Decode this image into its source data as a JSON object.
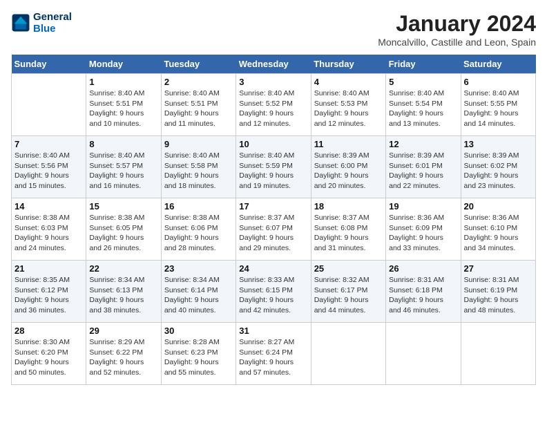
{
  "header": {
    "logo_line1": "General",
    "logo_line2": "Blue",
    "month_title": "January 2024",
    "subtitle": "Moncalvillo, Castille and Leon, Spain"
  },
  "days_of_week": [
    "Sunday",
    "Monday",
    "Tuesday",
    "Wednesday",
    "Thursday",
    "Friday",
    "Saturday"
  ],
  "weeks": [
    [
      {
        "day": "",
        "info": ""
      },
      {
        "day": "1",
        "info": "Sunrise: 8:40 AM\nSunset: 5:51 PM\nDaylight: 9 hours\nand 10 minutes."
      },
      {
        "day": "2",
        "info": "Sunrise: 8:40 AM\nSunset: 5:51 PM\nDaylight: 9 hours\nand 11 minutes."
      },
      {
        "day": "3",
        "info": "Sunrise: 8:40 AM\nSunset: 5:52 PM\nDaylight: 9 hours\nand 12 minutes."
      },
      {
        "day": "4",
        "info": "Sunrise: 8:40 AM\nSunset: 5:53 PM\nDaylight: 9 hours\nand 12 minutes."
      },
      {
        "day": "5",
        "info": "Sunrise: 8:40 AM\nSunset: 5:54 PM\nDaylight: 9 hours\nand 13 minutes."
      },
      {
        "day": "6",
        "info": "Sunrise: 8:40 AM\nSunset: 5:55 PM\nDaylight: 9 hours\nand 14 minutes."
      }
    ],
    [
      {
        "day": "7",
        "info": "Sunrise: 8:40 AM\nSunset: 5:56 PM\nDaylight: 9 hours\nand 15 minutes."
      },
      {
        "day": "8",
        "info": "Sunrise: 8:40 AM\nSunset: 5:57 PM\nDaylight: 9 hours\nand 16 minutes."
      },
      {
        "day": "9",
        "info": "Sunrise: 8:40 AM\nSunset: 5:58 PM\nDaylight: 9 hours\nand 18 minutes."
      },
      {
        "day": "10",
        "info": "Sunrise: 8:40 AM\nSunset: 5:59 PM\nDaylight: 9 hours\nand 19 minutes."
      },
      {
        "day": "11",
        "info": "Sunrise: 8:39 AM\nSunset: 6:00 PM\nDaylight: 9 hours\nand 20 minutes."
      },
      {
        "day": "12",
        "info": "Sunrise: 8:39 AM\nSunset: 6:01 PM\nDaylight: 9 hours\nand 22 minutes."
      },
      {
        "day": "13",
        "info": "Sunrise: 8:39 AM\nSunset: 6:02 PM\nDaylight: 9 hours\nand 23 minutes."
      }
    ],
    [
      {
        "day": "14",
        "info": "Sunrise: 8:38 AM\nSunset: 6:03 PM\nDaylight: 9 hours\nand 24 minutes."
      },
      {
        "day": "15",
        "info": "Sunrise: 8:38 AM\nSunset: 6:05 PM\nDaylight: 9 hours\nand 26 minutes."
      },
      {
        "day": "16",
        "info": "Sunrise: 8:38 AM\nSunset: 6:06 PM\nDaylight: 9 hours\nand 28 minutes."
      },
      {
        "day": "17",
        "info": "Sunrise: 8:37 AM\nSunset: 6:07 PM\nDaylight: 9 hours\nand 29 minutes."
      },
      {
        "day": "18",
        "info": "Sunrise: 8:37 AM\nSunset: 6:08 PM\nDaylight: 9 hours\nand 31 minutes."
      },
      {
        "day": "19",
        "info": "Sunrise: 8:36 AM\nSunset: 6:09 PM\nDaylight: 9 hours\nand 33 minutes."
      },
      {
        "day": "20",
        "info": "Sunrise: 8:36 AM\nSunset: 6:10 PM\nDaylight: 9 hours\nand 34 minutes."
      }
    ],
    [
      {
        "day": "21",
        "info": "Sunrise: 8:35 AM\nSunset: 6:12 PM\nDaylight: 9 hours\nand 36 minutes."
      },
      {
        "day": "22",
        "info": "Sunrise: 8:34 AM\nSunset: 6:13 PM\nDaylight: 9 hours\nand 38 minutes."
      },
      {
        "day": "23",
        "info": "Sunrise: 8:34 AM\nSunset: 6:14 PM\nDaylight: 9 hours\nand 40 minutes."
      },
      {
        "day": "24",
        "info": "Sunrise: 8:33 AM\nSunset: 6:15 PM\nDaylight: 9 hours\nand 42 minutes."
      },
      {
        "day": "25",
        "info": "Sunrise: 8:32 AM\nSunset: 6:17 PM\nDaylight: 9 hours\nand 44 minutes."
      },
      {
        "day": "26",
        "info": "Sunrise: 8:31 AM\nSunset: 6:18 PM\nDaylight: 9 hours\nand 46 minutes."
      },
      {
        "day": "27",
        "info": "Sunrise: 8:31 AM\nSunset: 6:19 PM\nDaylight: 9 hours\nand 48 minutes."
      }
    ],
    [
      {
        "day": "28",
        "info": "Sunrise: 8:30 AM\nSunset: 6:20 PM\nDaylight: 9 hours\nand 50 minutes."
      },
      {
        "day": "29",
        "info": "Sunrise: 8:29 AM\nSunset: 6:22 PM\nDaylight: 9 hours\nand 52 minutes."
      },
      {
        "day": "30",
        "info": "Sunrise: 8:28 AM\nSunset: 6:23 PM\nDaylight: 9 hours\nand 55 minutes."
      },
      {
        "day": "31",
        "info": "Sunrise: 8:27 AM\nSunset: 6:24 PM\nDaylight: 9 hours\nand 57 minutes."
      },
      {
        "day": "",
        "info": ""
      },
      {
        "day": "",
        "info": ""
      },
      {
        "day": "",
        "info": ""
      }
    ]
  ]
}
